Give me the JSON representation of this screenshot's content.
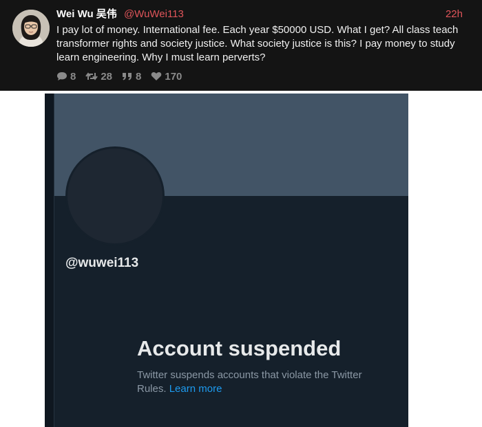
{
  "tweet": {
    "author_name": "Wei Wu 吴伟",
    "handle": "@WuWei113",
    "timestamp": "22h",
    "text": "I pay lot of money. International fee. Each year $50000 USD. What I get? All class teach transformer rights and society justice. What society justice is this? I pay money to study learn engineering. Why I must learn perverts?",
    "actions": {
      "replies": "8",
      "retweets": "28",
      "quotes": "8",
      "likes": "170"
    },
    "colors": {
      "accent": "#e0555a",
      "background": "#141414",
      "action_gray": "#8a8a8a"
    }
  },
  "profile": {
    "handle": "@wuwei113",
    "title": "Account suspended",
    "description": "Twitter suspends accounts that violate the Twitter Rules.",
    "learn_more": "Learn more",
    "colors": {
      "background": "#15202b",
      "banner": "#425466",
      "link": "#1d9bf0"
    }
  }
}
